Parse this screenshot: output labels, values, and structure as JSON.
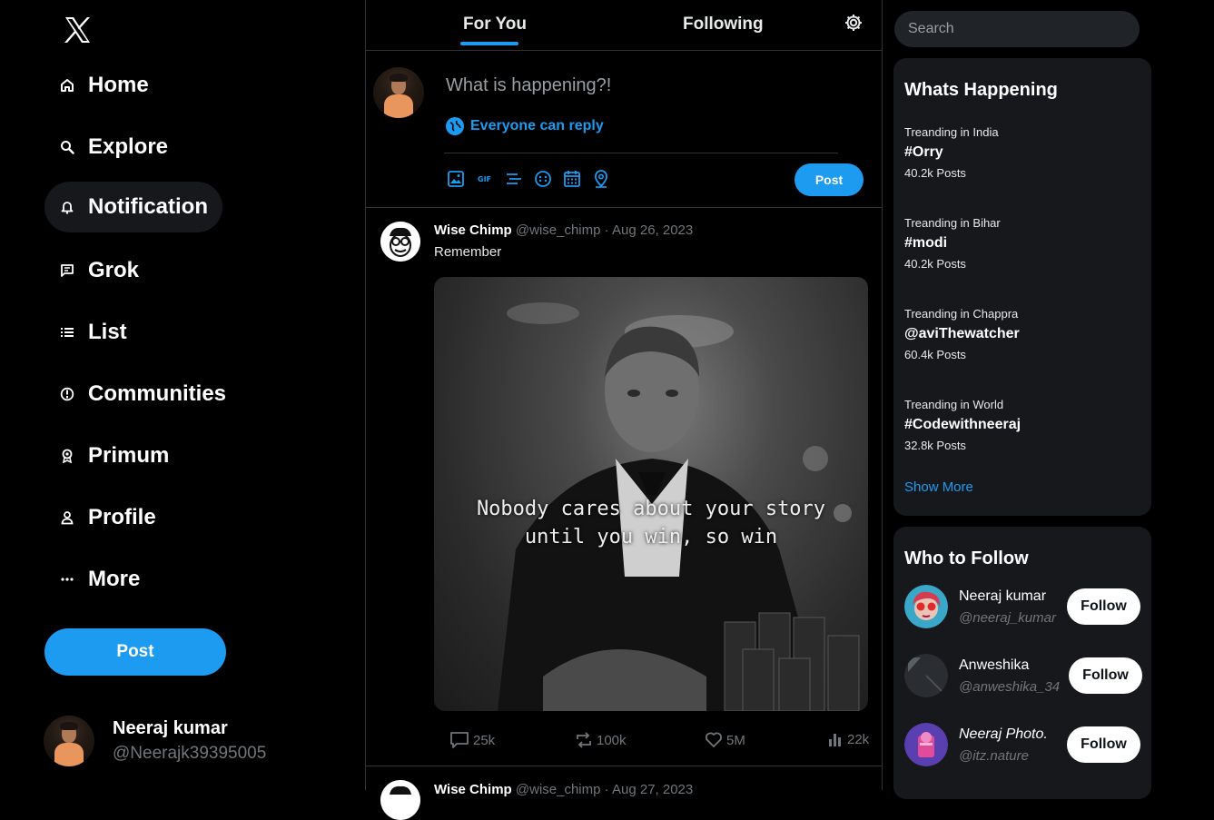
{
  "sidebar": {
    "logo": "x-logo-icon",
    "items": [
      {
        "label": "Home",
        "icon": "home-icon"
      },
      {
        "label": "Explore",
        "icon": "search-icon"
      },
      {
        "label": "Notification",
        "icon": "bell-icon"
      },
      {
        "label": "Grok",
        "icon": "grok-icon"
      },
      {
        "label": "List",
        "icon": "list-icon"
      },
      {
        "label": "Communities",
        "icon": "communities-icon"
      },
      {
        "label": "Primum",
        "icon": "premium-icon"
      },
      {
        "label": "Profile",
        "icon": "profile-icon"
      },
      {
        "label": "More",
        "icon": "more-icon"
      }
    ],
    "active": "Notification",
    "post_label": "Post",
    "account": {
      "name": "Neeraj kumar",
      "handle": "@Neerajk39395005"
    }
  },
  "feed": {
    "tabs": [
      "For You",
      "Following"
    ],
    "selected_tab": "For You",
    "composer": {
      "placeholder": "What is happening?!",
      "reply_setting": "Everyone can reply",
      "tools": [
        "image-icon",
        "gif-icon",
        "poll-icon",
        "emoji-icon",
        "schedule-icon",
        "location-icon"
      ],
      "post_label": "Post"
    },
    "tweets": [
      {
        "name": "Wise Chimp",
        "handle": "@wise_chimp",
        "date": "· Aug 26, 2023",
        "text": "Remember",
        "media_caption_line1": "Nobody cares about your story",
        "media_caption_line2": "until you win, so win",
        "replies": "25k",
        "reposts": "100k",
        "likes": "5M",
        "views": "22k"
      },
      {
        "name": "Wise Chimp",
        "handle": "@wise_chimp",
        "date": "· Aug 27, 2023"
      }
    ]
  },
  "right": {
    "search_placeholder": "Search",
    "trends_title": "Whats Happening",
    "trends": [
      {
        "context": "Treanding in India",
        "tag": "#Orry",
        "count": "40.2k Posts"
      },
      {
        "context": "Treanding in Bihar",
        "tag": "#modi",
        "count": "40.2k Posts"
      },
      {
        "context": "Treanding in Chappra",
        "tag": "@aviThewatcher",
        "count": "60.4k Posts"
      },
      {
        "context": "Treanding in World",
        "tag": "#Codewithneeraj",
        "count": "32.8k Posts"
      }
    ],
    "show_more": "Show More",
    "follow_title": "Who to Follow",
    "who_to_follow": [
      {
        "name": "Neeraj kumar",
        "handle": "@neeraj_kumar",
        "button": "Follow"
      },
      {
        "name": "Anweshika",
        "handle": "@anweshika_34",
        "button": "Follow"
      },
      {
        "name": "Neeraj Photo.",
        "handle": "@itz.nature",
        "button": "Follow"
      }
    ]
  },
  "colors": {
    "accent": "#1d9bf0",
    "background": "#000000",
    "card": "#16181c",
    "muted": "#71767b"
  }
}
